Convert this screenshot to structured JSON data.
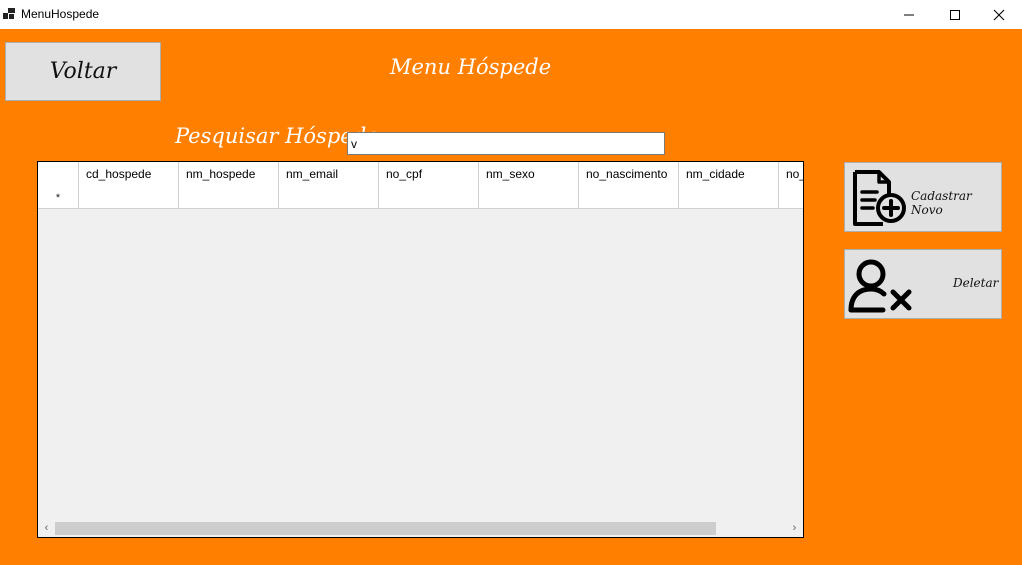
{
  "window": {
    "title": "MenuHospede",
    "controls": [
      "minimize-icon",
      "maximize-icon",
      "close-icon"
    ]
  },
  "header": {
    "back_button": "Voltar",
    "page_title": "Menu Hóspede"
  },
  "search": {
    "label": "Pesquisar Hóspede:",
    "value": "v"
  },
  "grid": {
    "columns": [
      "cd_hospede",
      "nm_hospede",
      "nm_email",
      "no_cpf",
      "nm_sexo",
      "no_nascimento",
      "nm_cidade",
      "no_"
    ],
    "new_row_marker": "*",
    "rows": []
  },
  "actions": {
    "add_label": "Cadastrar Novo",
    "add_icon": "document-add-icon",
    "delete_label": "Deletar",
    "delete_icon": "user-remove-icon"
  },
  "colors": {
    "background": "#ff7f00",
    "button": "#e1e1e1"
  }
}
